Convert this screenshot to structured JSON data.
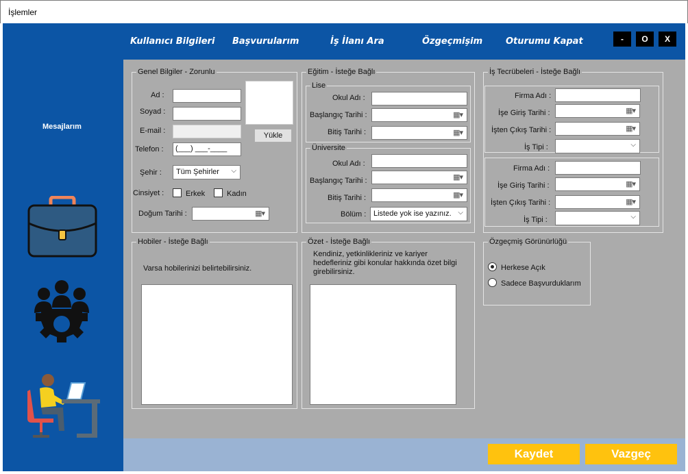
{
  "window": {
    "title": "İşlemler"
  },
  "nav": {
    "items": [
      "Kullanıcı Bilgileri",
      "Başvurularım",
      "İş İlanı Ara",
      "Özgeçmişim",
      "Oturumu Kapat"
    ],
    "minimize": "-",
    "maximize": "O",
    "close": "X"
  },
  "sidebar": {
    "messages": "Mesajlarım",
    "icons": [
      "briefcase-icon",
      "team-gear-icon",
      "person-at-laptop-icon"
    ]
  },
  "general": {
    "legend": "Genel Bilgiler - Zorunlu",
    "name_label": "Ad :",
    "surname_label": "Soyad :",
    "email_label": "E-mail :",
    "phone_label": "Telefon :",
    "phone_value": "(___) ___-____",
    "upload_button": "Yükle",
    "city_label": "Şehir :",
    "city_value": "Tüm Şehirler",
    "gender_label": "Cinsiyet :",
    "male_label": "Erkek",
    "female_label": "Kadın",
    "birthdate_label": "Doğum Tarihi :"
  },
  "education": {
    "legend": "Eğitim - İsteğe Bağlı",
    "high_school": {
      "legend": "Lise",
      "school_label": "Okul Adı :",
      "start_label": "Başlangıç Tarihi :",
      "end_label": "Bitiş Tarihi :"
    },
    "university": {
      "legend": "Üniversite",
      "school_label": "Okul Adı :",
      "start_label": "Başlangıç Tarihi :",
      "end_label": "Bitiş Tarihi :",
      "department_label": "Bölüm :",
      "department_value": "Listede yok ise yazınız."
    }
  },
  "experience": {
    "legend": "İş Tecrübeleri - İsteğe Bağlı",
    "entries": [
      {
        "company_label": "Firma Adı :",
        "start_label": "İşe Giriş Tarihi :",
        "end_label": "İşten Çıkış Tarihi :",
        "type_label": "İş Tipi :"
      },
      {
        "company_label": "Firma Adı :",
        "start_label": "İşe Giriş Tarihi :",
        "end_label": "İşten Çıkış Tarihi :",
        "type_label": "İş Tipi :"
      }
    ]
  },
  "hobbies": {
    "legend": "Hobiler - İsteğe Bağlı",
    "hint": "Varsa hobilerinizi belirtebilirsiniz."
  },
  "summary": {
    "legend": "Özet - İsteğe Bağlı",
    "hint_line1": "Kendiniz, yetkinlikleriniz ve kariyer",
    "hint_line2": "hedefleriniz gibi konular hakkında özet bilgi",
    "hint_line3": "girebilirsiniz."
  },
  "visibility": {
    "legend": "Özgeçmiş Görünürlüğü",
    "option_all": "Herkese Açık",
    "option_applied": "Sadece Başvurduklarım",
    "selected": "Herkese Açık"
  },
  "actions": {
    "save": "Kaydet",
    "cancel": "Vazgeç"
  },
  "colors": {
    "primary": "#0c55a5",
    "accent": "#ffc20e",
    "panel": "#ababab",
    "footer": "#9ab3d3"
  }
}
